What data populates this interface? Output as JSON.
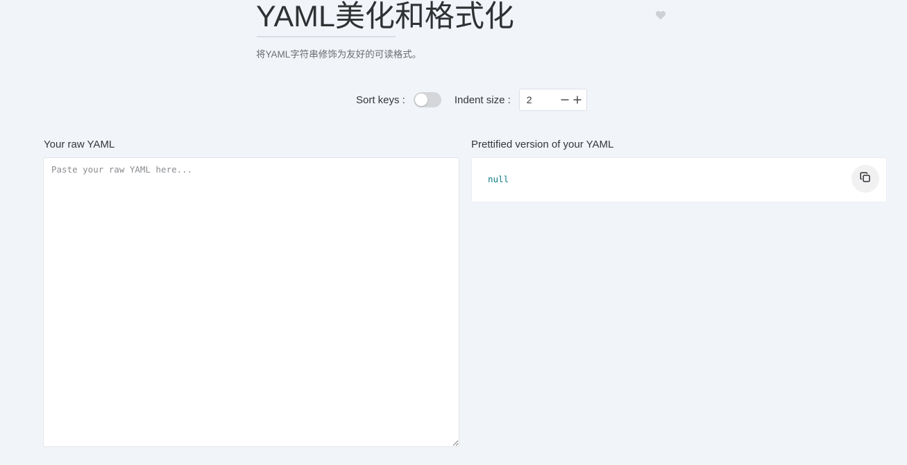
{
  "header": {
    "title": "YAML美化和格式化",
    "subtitle": "将YAML字符串修饰为友好的可读格式。",
    "favorite_icon": "heart-icon"
  },
  "options": {
    "sort_keys_label": "Sort keys :",
    "sort_keys_enabled": false,
    "indent_label": "Indent size :",
    "indent_value": "2",
    "decrement_icon": "minus-icon",
    "increment_icon": "plus-icon"
  },
  "input_panel": {
    "label": "Your raw YAML",
    "placeholder": "Paste your raw YAML here...",
    "value": ""
  },
  "output_panel": {
    "label": "Prettified version of your YAML",
    "code": "null",
    "copy_icon": "copy-icon"
  },
  "colors": {
    "background": "#f1f4f9",
    "code_text": "#0e7a85",
    "switch_off": "#d4d6d9"
  }
}
